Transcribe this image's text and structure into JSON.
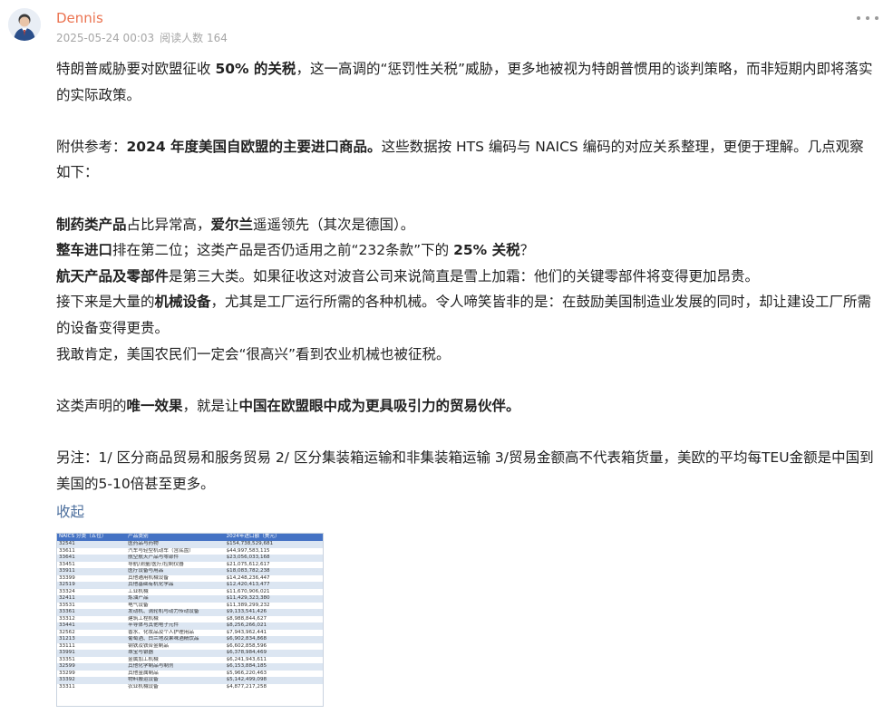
{
  "author": {
    "name": "Dennis"
  },
  "meta": {
    "date": "2025-05-24 00:03",
    "reads": "阅读人数 164"
  },
  "icons": {
    "more": "more-dots-icon",
    "avatar": "user-avatar"
  },
  "colors": {
    "author": "#eb7350",
    "link": "#4a6d9c",
    "table_header": "#4472c4",
    "table_stripe": "#dce6f2"
  },
  "post": {
    "p1": {
      "t1": "特朗普威胁要对欧盟征收 ",
      "b1": "50% 的关税",
      "t2": "，这一高调的“惩罚性关税”威胁，更多地被视为特朗普惯用的谈判策略，而非短期内即将落实的实际政策。"
    },
    "p2": {
      "t1": "附供参考：",
      "b1": "2024 年度美国自欧盟的主要进口商品。",
      "t2": "这些数据按 HTS 编码与 NAICS 编码的对应关系整理，更便于理解。几点观察如下："
    },
    "p3": {
      "b1": "制药类产品",
      "t1": "占比异常高，",
      "b2": "爱尔兰",
      "t2": "遥遥领先（其次是德国）。"
    },
    "p4": {
      "b1": "整车进口",
      "t1": "排在第二位；这类产品是否仍适用之前“232条款”下的 ",
      "b2": "25% 关税",
      "t2": "？"
    },
    "p5": {
      "b1": "航天产品及零部件",
      "t1": "是第三大类。如果征收这对波音公司来说简直是雪上加霜：他们的关键零部件将变得更加昂贵。"
    },
    "p6": {
      "t1": "接下来是大量的",
      "b1": "机械设备",
      "t2": "，尤其是工厂运行所需的各种机械。令人啼笑皆非的是：在鼓励美国制造业发展的同时，却让建设工厂所需的设备变得更贵。"
    },
    "p7": {
      "t1": "我敢肯定，美国农民们一定会“很高兴”看到农业机械也被征税。"
    },
    "p8": {
      "t1": "这类声明的",
      "b1": "唯一效果",
      "t2": "，就是让",
      "b2": "中国在欧盟眼中成为更具吸引力的贸易伙伴。"
    },
    "p9": {
      "t1": "另注：1/ 区分商品贸易和服务贸易  2/ 区分集装箱运输和非集装箱运输 3/贸易金额高不代表箱货量，美欧的平均每TEU金额是中国到美国的5-10倍甚至更多。"
    }
  },
  "collapse_label": "收起",
  "table": {
    "headers": [
      "NAICS 分类（五位）",
      "产品类别",
      "2024年进口额（美元）"
    ],
    "rows": [
      [
        "32541",
        "医药品与药物",
        "$154,738,529,681"
      ],
      [
        "33611",
        "汽车与轻型机动车（含底盘）",
        "$44,997,583,115"
      ],
      [
        "33641",
        "航空航天产品与零部件",
        "$23,056,033,168"
      ],
      [
        "33451",
        "导航/测量/医疗/控制仪器",
        "$21,075,612,617"
      ],
      [
        "33911",
        "医疗设备与用品",
        "$18,083,782,238"
      ],
      [
        "33399",
        "其他通用机械设备",
        "$14,248,236,447"
      ],
      [
        "32519",
        "其他基础有机化学品",
        "$12,420,413,477"
      ],
      [
        "33324",
        "工业机械",
        "$11,670,906,021"
      ],
      [
        "32411",
        "炼油产品",
        "$11,429,323,380"
      ],
      [
        "33531",
        "电气设备",
        "$11,389,299,232"
      ],
      [
        "33361",
        "发动机、涡轮机与动力传动设备",
        "$9,133,541,426"
      ],
      [
        "33312",
        "建筑工程机械",
        "$8,988,844,627"
      ],
      [
        "33441",
        "半导体与其他电子元件",
        "$8,256,266,021"
      ],
      [
        "32562",
        "香水、化妆品及个人护理用品",
        "$7,943,962,441"
      ],
      [
        "31213",
        "葡萄酒、白兰地及果味酒精饮品",
        "$6,902,834,868"
      ],
      [
        "33111",
        "钢铁及铁合金制品",
        "$6,602,858,596"
      ],
      [
        "33991",
        "珠宝与银器",
        "$6,378,984,469"
      ],
      [
        "33351",
        "金属加工机械",
        "$6,241,943,611"
      ],
      [
        "32599",
        "其他化学制品与制剂",
        "$6,153,884,185"
      ],
      [
        "33299",
        "其他金属制品",
        "$5,966,220,463"
      ],
      [
        "33392",
        "物料搬运设备",
        "$5,142,499,098"
      ],
      [
        "33311",
        "农业机械设备",
        "$4,877,217,258"
      ]
    ]
  }
}
